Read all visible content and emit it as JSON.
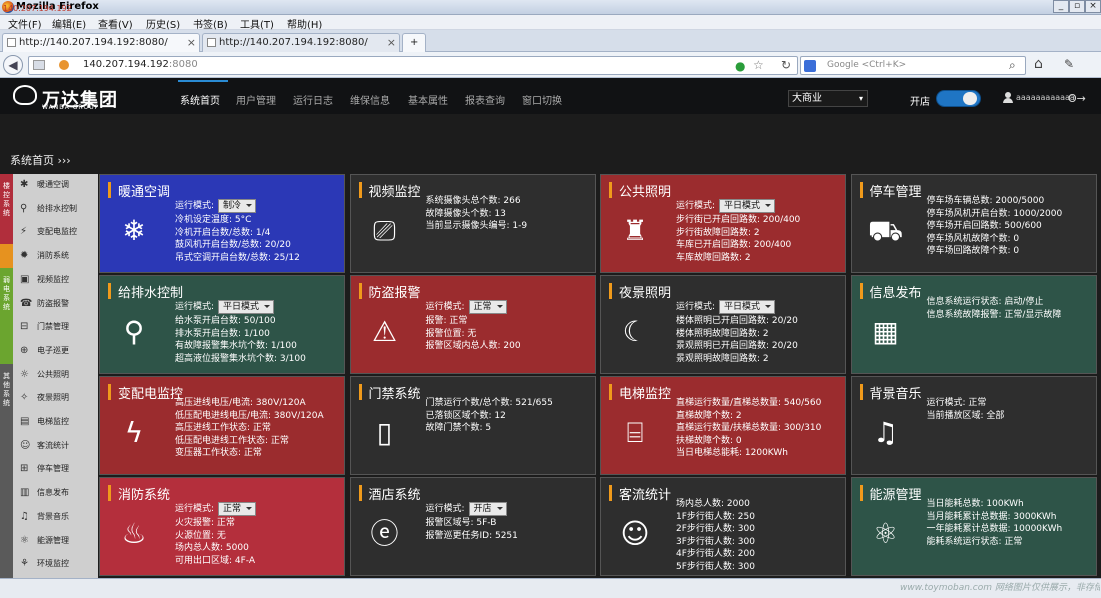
{
  "window": {
    "title": "Mozilla Firefox"
  },
  "menu": [
    "文件(F)",
    "编辑(E)",
    "查看(V)",
    "历史(S)",
    "书签(B)",
    "工具(T)",
    "帮助(H)"
  ],
  "tabs": [
    {
      "label": "http://140.207.194.192:8080/"
    },
    {
      "label": "http://140.207.194.192:8080/"
    }
  ],
  "new_tab": "+",
  "url": {
    "host": "140.207.194.192",
    "port": ":8080"
  },
  "search": {
    "placeholder": "Google <Ctrl+K>"
  },
  "brand": {
    "cn": "万达集团",
    "en": "WANDA GROUP"
  },
  "nav": [
    "系统首页",
    "用户管理",
    "运行日志",
    "维保信息",
    "基本属性",
    "报表查询",
    "窗口切换"
  ],
  "mall_select": "大商业",
  "open_label": "开店",
  "user": {
    "name": "aaaaaaaaaaaa"
  },
  "breadcrumb": "系统首页",
  "sidebar": {
    "groups": [
      "楼控系统",
      "弱电系统",
      "其他系统"
    ],
    "items": [
      "暖通空调",
      "给排水控制",
      "变配电监控",
      "消防系统",
      "视频监控",
      "防盗报警",
      "门禁管理",
      "电子巡更",
      "公共照明",
      "夜景照明",
      "电梯监控",
      "客流统计",
      "停车管理",
      "信息发布",
      "背景音乐",
      "能源管理",
      "环境监控"
    ]
  },
  "tiles": [
    {
      "title": "暖通空调",
      "color": "#2b38b6",
      "mode_label": "运行模式:",
      "mode": "制冷",
      "lines": [
        "冷机设定温度: 5°C",
        "冷机开启台数/总数: 1/4",
        "鼓风机开启台数/总数: 20/20",
        "吊式空调开启台数/总数: 25/12"
      ]
    },
    {
      "title": "视频监控",
      "color": "#2e2e2e",
      "lines": [
        "系统摄像头总个数: 266",
        "故障摄像头个数: 13",
        "当前显示摄像头编号: 1-9"
      ]
    },
    {
      "title": "公共照明",
      "color": "#9b2c2e",
      "mode_label": "运行模式:",
      "mode": "平日模式",
      "lines": [
        "步行街已开启回路数: 200/400",
        "步行街故障回路数: 2",
        "车库已开启回路数: 200/400",
        "车库故障回路数: 2"
      ]
    },
    {
      "title": "停车管理",
      "color": "#2e2e2e",
      "lines": [
        "停车场车辆总数: 2000/5000",
        "停车场风机开启台数: 1000/2000",
        "停车场开启回路数: 500/600",
        "停车场风机故障个数: 0",
        "停车场回路故障个数: 0"
      ]
    },
    {
      "title": "给排水控制",
      "color": "#2e5448",
      "mode_label": "运行模式:",
      "mode": "平日模式",
      "lines": [
        "给水泵开启台数: 50/100",
        "排水泵开启台数: 1/100",
        "有故障报警集水坑个数: 1/100",
        "超高液位报警集水坑个数: 3/100"
      ]
    },
    {
      "title": "防盗报警",
      "color": "#9b2c2e",
      "mode_label": "运行模式:",
      "mode": "正常",
      "lines": [
        "报警: 正常",
        "报警位置: 无",
        "报警区域内总人数: 200"
      ]
    },
    {
      "title": "夜景照明",
      "color": "#2e2e2e",
      "mode_label": "运行模式:",
      "mode": "平日模式",
      "lines": [
        "楼体照明已开启回路数: 20/20",
        "楼体照明故障回路数: 2",
        "景观照明已开启回路数: 20/20",
        "景观照明故障回路数: 2"
      ]
    },
    {
      "title": "信息发布",
      "color": "#2e5448",
      "lines": [
        "信息系统运行状态: 启动/停止",
        "信息系统故障报警: 正常/显示故障"
      ]
    },
    {
      "title": "变配电监控",
      "color": "#9b2c2e",
      "lines": [
        "高压进线电压/电流: 380V/120A",
        "低压配电进线电压/电流: 380V/120A",
        "高压进线工作状态: 正常",
        "低压配电进线工作状态: 正常",
        "变压器工作状态: 正常"
      ]
    },
    {
      "title": "门禁系统",
      "color": "#2e2e2e",
      "lines": [
        "门禁运行个数/总个数: 521/655",
        "已落锁区域个数: 12",
        "故障门禁个数: 5"
      ]
    },
    {
      "title": "电梯监控",
      "color": "#9b2c2e",
      "lines": [
        "直梯运行数量/直梯总数量: 540/560",
        "直梯故障个数: 2",
        "直梯运行数量/扶梯总数量: 300/310",
        "扶梯故障个数: 0",
        "当日电梯总能耗: 1200KWh"
      ]
    },
    {
      "title": "背景音乐",
      "color": "#2e2e2e",
      "lines": [
        "运行模式: 正常",
        "当前播放区域: 全部"
      ]
    },
    {
      "title": "消防系统",
      "color": "#b42f3c",
      "mode_label": "运行模式:",
      "mode": "正常",
      "lines": [
        "火灾报警: 正常",
        "火源位置: 无",
        "场内总人数: 5000",
        "可用出口区域: 4F-A"
      ]
    },
    {
      "title": "酒店系统",
      "color": "#2e2e2e",
      "mode_label": "运行模式:",
      "mode": "开店",
      "lines": [
        "报警区域号: 5F-B",
        "报警巡更任务ID: 5251"
      ]
    },
    {
      "title": "客流统计",
      "color": "#2e2e2e",
      "lines": [
        "场内总人数: 2000",
        "1F步行街人数: 250",
        "2F步行街人数: 300",
        "3F步行街人数: 300",
        "4F步行街人数: 200",
        "5F步行街人数: 300"
      ]
    },
    {
      "title": "能源管理",
      "color": "#2e5448",
      "lines": [
        "当日能耗总数: 100KWh",
        "当月能耗累计总数据: 3000KWh",
        "一年能耗累计总数据: 10000KWh",
        "能耗系统运行状态: 正常"
      ]
    }
  ],
  "tile_icons": [
    "snowflake-fan-icon",
    "camera-icon",
    "lamp-icon",
    "car-icon",
    "faucet-icon",
    "siren-icon",
    "moon-icon",
    "grid-board-icon",
    "lightning-icon",
    "door-icon",
    "elevator-icon",
    "music-icon",
    "fire-icon",
    "hotel-e-icon",
    "people-icon",
    "atom-icon"
  ],
  "status": "140.207.194.192",
  "watermark": "www.toymoban.com 网络图片仅供展示，非存储，如有侵权请联系删除。"
}
